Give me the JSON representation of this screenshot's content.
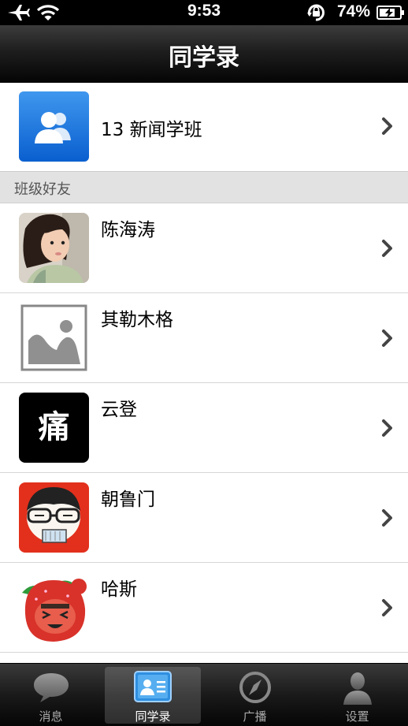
{
  "status_bar": {
    "time": "9:53",
    "battery_percent": "74%"
  },
  "nav": {
    "title": "同学录"
  },
  "class_group": {
    "label": "13 新闻学班",
    "icon": "contacts-icon"
  },
  "section": {
    "header": "班级好友"
  },
  "friends": [
    {
      "name": "陈海涛",
      "avatar": "photo-girl"
    },
    {
      "name": "其勒木格",
      "avatar": "placeholder-image"
    },
    {
      "name": "云登",
      "avatar": "black-tile",
      "avatar_text": "痛"
    },
    {
      "name": "朝鲁门",
      "avatar": "cartoon-glasses"
    },
    {
      "name": "哈斯",
      "avatar": "cartoon-strawberry"
    }
  ],
  "tabs": [
    {
      "label": "消息",
      "icon": "chat-bubble-icon",
      "active": false
    },
    {
      "label": "同学录",
      "icon": "contact-card-icon",
      "active": true
    },
    {
      "label": "广播",
      "icon": "compass-icon",
      "active": false
    },
    {
      "label": "设置",
      "icon": "person-icon",
      "active": false
    }
  ],
  "colors": {
    "accent_blue": "#1a72dd",
    "nav_dark": "#1e1e1e",
    "section_bg": "#e2e2e2"
  }
}
